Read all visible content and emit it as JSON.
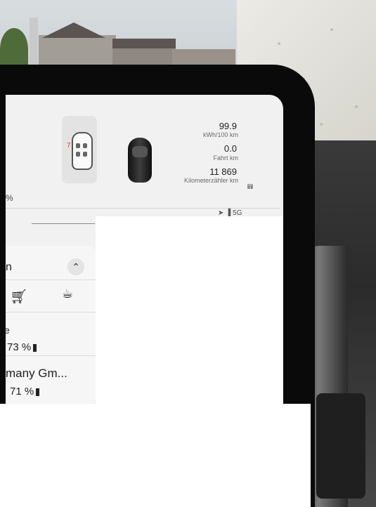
{
  "trip": {
    "consumption_value": "99.9",
    "consumption_unit": "kWh/100 km",
    "trip_value": "0.0",
    "trip_unit": "Fahrt km",
    "odometer_value": "11 869",
    "odometer_unit": "Kilometerzähler km"
  },
  "car": {
    "door_number": "7"
  },
  "left_percent": "%",
  "status": {
    "signal_label": "5G"
  },
  "panel": {
    "row1_label": "n",
    "cart_icon": "shopping-cart-icon",
    "coffee_icon": "coffee-icon",
    "row2_prefix": "e",
    "row2_battery": "73 %",
    "row3_label": "many Gm...",
    "row3_battery": "71 %"
  }
}
